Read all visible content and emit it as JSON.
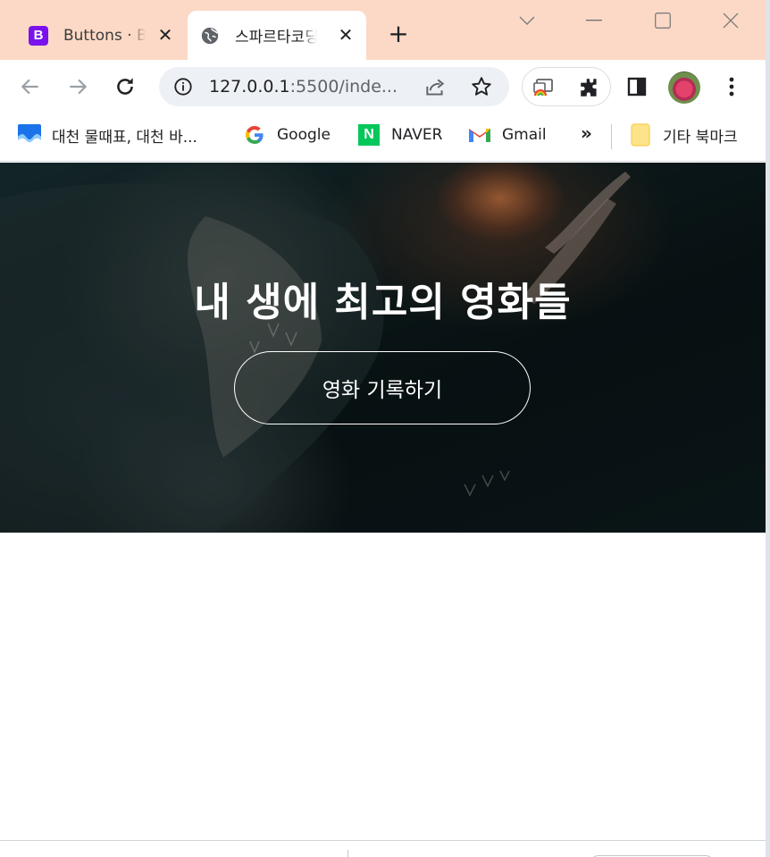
{
  "tabs": [
    {
      "title": "Buttons · Bootstrap",
      "favicon": "bootstrap-icon",
      "letter": "B",
      "active": false
    },
    {
      "title": "스파르타코딩클럽",
      "favicon": "globe-icon",
      "active": true
    }
  ],
  "toolbar": {
    "url_host": "127.0.0.1",
    "url_rest": ":5500/inde..."
  },
  "bookmarks": [
    {
      "label": "대천 물때표, 대천 바...",
      "icon": "wave-icon"
    },
    {
      "label": "Google",
      "icon": "google-icon"
    },
    {
      "label": "NAVER",
      "icon": "naver-icon",
      "letter": "N"
    },
    {
      "label": "Gmail",
      "icon": "gmail-icon"
    }
  ],
  "bookmarks_more": "»",
  "other_bookmarks": "기타 북마크",
  "hero": {
    "title": "내 생에 최고의 영화들",
    "button_label": "영화 기록하기"
  },
  "colors": {
    "tabstrip": "#fcd9c6",
    "bootstrap": "#7a12ee",
    "naver": "#03c75a"
  }
}
